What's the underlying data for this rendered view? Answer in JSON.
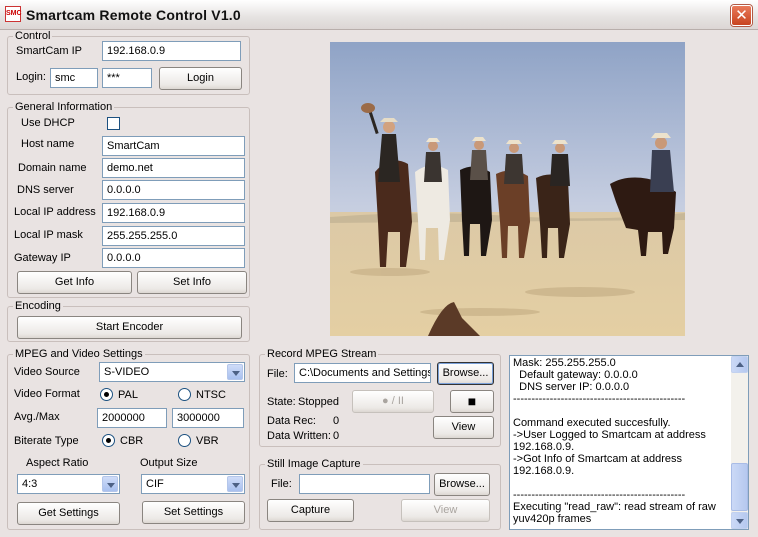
{
  "window": {
    "title": "Smartcam Remote Control V1.0",
    "app_icon_text": "SMC",
    "close_symbol": "✕"
  },
  "control": {
    "legend": "Control",
    "ip_label": "SmartCam IP",
    "ip_value": "192.168.0.9",
    "login_label": "Login:",
    "user_value": "smc",
    "password_value": "***",
    "login_button": "Login"
  },
  "general": {
    "legend": "General Information",
    "dhcp_label": "Use DHCP",
    "host_label": "Host name",
    "host_value": "SmartCam",
    "domain_label": "Domain name",
    "domain_value": "demo.net",
    "dns_label": "DNS server",
    "dns_value": "0.0.0.0",
    "ip_label": "Local IP address",
    "ip_value": "192.168.0.9",
    "mask_label": "Local IP mask",
    "mask_value": "255.255.255.0",
    "gateway_label": "Gateway IP",
    "gateway_value": "0.0.0.0",
    "get_info": "Get Info",
    "set_info": "Set Info"
  },
  "encoding": {
    "legend": "Encoding",
    "start_encoder": "Start Encoder"
  },
  "mpeg": {
    "legend": "MPEG and Video Settings",
    "video_source_label": "Video Source",
    "video_source_value": "S-VIDEO",
    "video_format_label": "Video Format",
    "pal_label": "PAL",
    "ntsc_label": "NTSC",
    "avg_max_label": "Avg./Max",
    "avg_value": "2000000",
    "max_value": "3000000",
    "bitrate_label": "Biterate Type",
    "cbr_label": "CBR",
    "vbr_label": "VBR",
    "aspect_label": "Aspect Ratio",
    "aspect_value": "4:3",
    "output_label": "Output Size",
    "output_value": "CIF",
    "get_settings": "Get Settings",
    "set_settings": "Set Settings"
  },
  "record": {
    "legend": "Record MPEG Stream",
    "file_label": "File:",
    "file_value": "C:\\Documents and Settings",
    "browse": "Browse...",
    "state_label": "State:",
    "state_value": "Stopped",
    "play_pause_label": "● / II",
    "stop_symbol": "■",
    "data_rec_label": "Data Rec:",
    "data_rec_value": "0",
    "data_written_label": "Data Written:",
    "data_written_value": "0",
    "view": "View"
  },
  "still": {
    "legend": "Still Image Capture",
    "file_label": "File:",
    "file_value": "",
    "browse": "Browse...",
    "capture": "Capture",
    "view": "View"
  },
  "log": {
    "lines": [
      "Mask: 255.255.255.0",
      "  Default gateway: 0.0.0.0",
      "  DNS server IP: 0.0.0.0",
      "-----------------------------------------------",
      "",
      "Command executed succesfully.",
      "->User Logged to Smartcam at address 192.168.0.9.",
      "->Got Info of Smartcam at address 192.168.0.9.",
      "",
      "-----------------------------------------------",
      "Executing \"read_raw\": read stream of raw yuv420p frames"
    ]
  }
}
